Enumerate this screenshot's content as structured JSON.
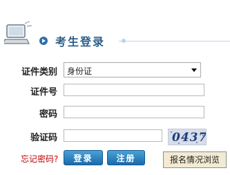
{
  "header": {
    "title": "考生登录"
  },
  "form": {
    "id_type": {
      "label": "证件类别",
      "value": "身份证"
    },
    "id_number": {
      "label": "证件号",
      "value": ""
    },
    "password": {
      "label": "密码",
      "value": ""
    },
    "captcha": {
      "label": "验证码",
      "value": "",
      "image_text": "0437"
    }
  },
  "actions": {
    "forgot_label": "忘记密码?",
    "login_label": "登录",
    "register_label": "注册",
    "status_label": "报名情况浏览"
  },
  "colors": {
    "title": "#2d5f8a",
    "button_blue": "#1a6aab",
    "forgot_red": "#c00000"
  }
}
